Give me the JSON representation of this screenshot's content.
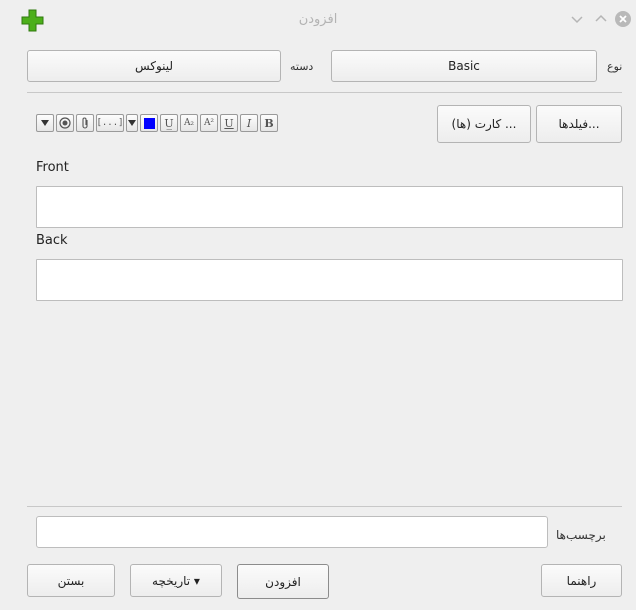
{
  "window": {
    "title": "افزودن"
  },
  "top_row": {
    "type_label": "نوع",
    "type_value": "Basic",
    "deck_label": "دسته",
    "deck_value": "لینوکس"
  },
  "editor_toolbar": {
    "fields_button": "فیلدها...",
    "cards_button": "کارت (ها) ...",
    "format_buttons": [
      "B",
      "I",
      "U",
      "A²",
      "A₂",
      "U̲"
    ],
    "cloze_glyph": "[...]",
    "color_accent": "#0000ff"
  },
  "fields": [
    {
      "label": "Front",
      "value": ""
    },
    {
      "label": "Back",
      "value": ""
    }
  ],
  "tags": {
    "label": "برچسب‌ها",
    "value": ""
  },
  "bottom_buttons": {
    "help": "راهنما",
    "add": "افزودن",
    "history": "تاریخچه ▾",
    "close": "بستن"
  }
}
